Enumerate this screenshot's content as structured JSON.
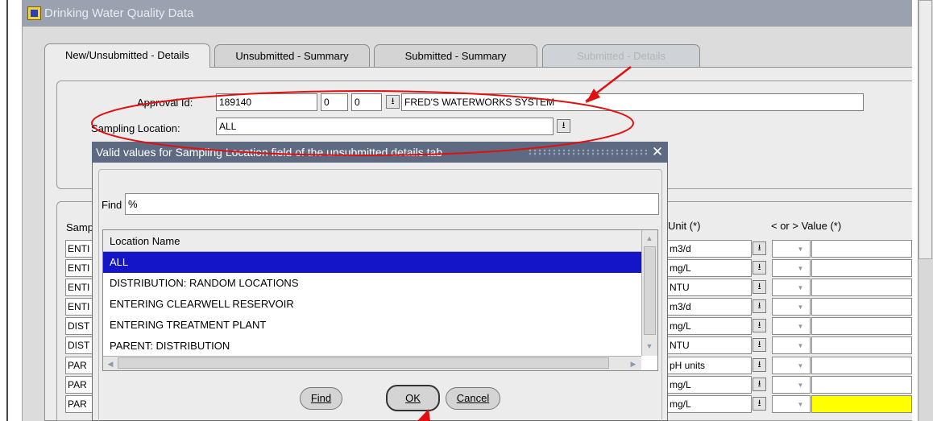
{
  "window": {
    "title": "Drinking Water Quality Data"
  },
  "tabs": [
    {
      "label": "New/Unsubmitted - Details"
    },
    {
      "label": "Unsubmitted - Summary"
    },
    {
      "label": "Submitted - Summary"
    },
    {
      "label": "Submitted - Details"
    }
  ],
  "form": {
    "approval_label": "Approval Id:",
    "approval_id": "189140",
    "approval_field2": "0",
    "approval_field3": "0",
    "system_name": "FRED'S WATERWORKS SYSTEM",
    "sampling_label": "Sampling Location:",
    "sampling_value": "ALL"
  },
  "table": {
    "header_sample_fragment": "Samp",
    "header_unit": "Unit (*)",
    "header_value": "< or >  Value (*)",
    "row_prefixes": [
      "ENTI",
      "ENTI",
      "ENTI",
      "ENTI",
      "DIST",
      "DIST",
      "PAR",
      "PAR",
      "PAR"
    ],
    "units": [
      "m3/d",
      "mg/L",
      "NTU",
      "m3/d",
      "mg/L",
      "NTU",
      "pH units",
      "mg/L",
      "mg/L"
    ]
  },
  "dialog": {
    "title": "Valid values for Sampling Location field of the unsubmitted details tab",
    "find_label": "Find",
    "find_value": "%",
    "list_header": "Location Name",
    "items": [
      {
        "label": "ALL",
        "selected": true
      },
      {
        "label": "DISTRIBUTION: RANDOM LOCATIONS",
        "selected": false
      },
      {
        "label": "ENTERING CLEARWELL RESERVOIR",
        "selected": false
      },
      {
        "label": "ENTERING TREATMENT PLANT",
        "selected": false
      },
      {
        "label": "PARENT: DISTRIBUTION",
        "selected": false
      }
    ],
    "buttons": {
      "find": "Find",
      "ok": "OK",
      "cancel": "Cancel"
    }
  },
  "colors": {
    "selection": "#1414c8",
    "titlebar": "#9aa2b0",
    "dialog_titlebar": "#5d6a82",
    "annotation": "#e01010",
    "highlight_cell": "#ffff00"
  }
}
